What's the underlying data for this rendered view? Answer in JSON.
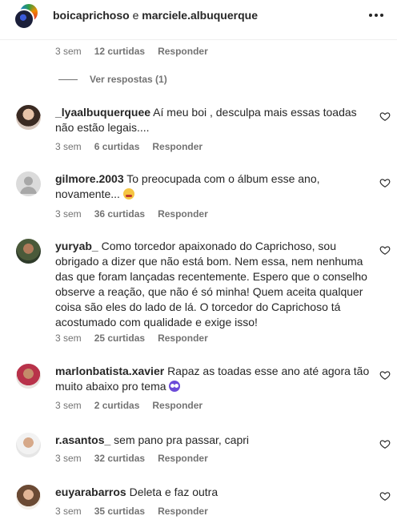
{
  "header": {
    "user_a": "boicaprichoso",
    "conjunction": "e",
    "user_b": "marciele.albuquerque"
  },
  "top_meta": {
    "time": "3 sem",
    "likes": "12 curtidas",
    "reply": "Responder"
  },
  "view_replies": "Ver respostas (1)",
  "comments": [
    {
      "user": "_lyaalbuquerquee",
      "text": "Aí meu boi , desculpa mais essas toadas não estão legais....",
      "time": "3 sem",
      "likes": "6 curtidas",
      "reply": "Responder"
    },
    {
      "user": "gilmore.2003",
      "text": "To preocupada com o álbum esse ano, novamente...",
      "emoji": "worried-face-emoji",
      "time": "3 sem",
      "likes": "36 curtidas",
      "reply": "Responder"
    },
    {
      "user": "yuryab_",
      "text": "Como torcedor apaixonado do Caprichoso, sou obrigado a dizer que não está bom. Nem essa, nem nenhuma das que foram lançadas recentemente. Espero que o conselho observe a reação, que não é só minha! Quem aceita qualquer coisa são eles do lado de lá. O torcedor do Caprichoso tá acostumado com qualidade e exige isso!",
      "time": "3 sem",
      "likes": "25 curtidas",
      "reply": "Responder"
    },
    {
      "user": "marlonbatista.xavier",
      "text": "Rapaz as toadas esse ano até agora tão muito abaixo pro tema",
      "emoji": "eyes-emoji",
      "time": "3 sem",
      "likes": "2 curtidas",
      "reply": "Responder"
    },
    {
      "user": "r.asantos_",
      "text": "sem pano pra passar, capri",
      "time": "3 sem",
      "likes": "32 curtidas",
      "reply": "Responder"
    },
    {
      "user": "euyarabarros",
      "text": "Deleta e faz outra",
      "time": "3 sem",
      "likes": "35 curtidas",
      "reply": "Responder"
    }
  ],
  "icons": {
    "more": "more-options-icon",
    "like": "heart-icon"
  },
  "colors": {
    "text": "#262626",
    "secondary": "#737373",
    "divider": "#efefef"
  }
}
